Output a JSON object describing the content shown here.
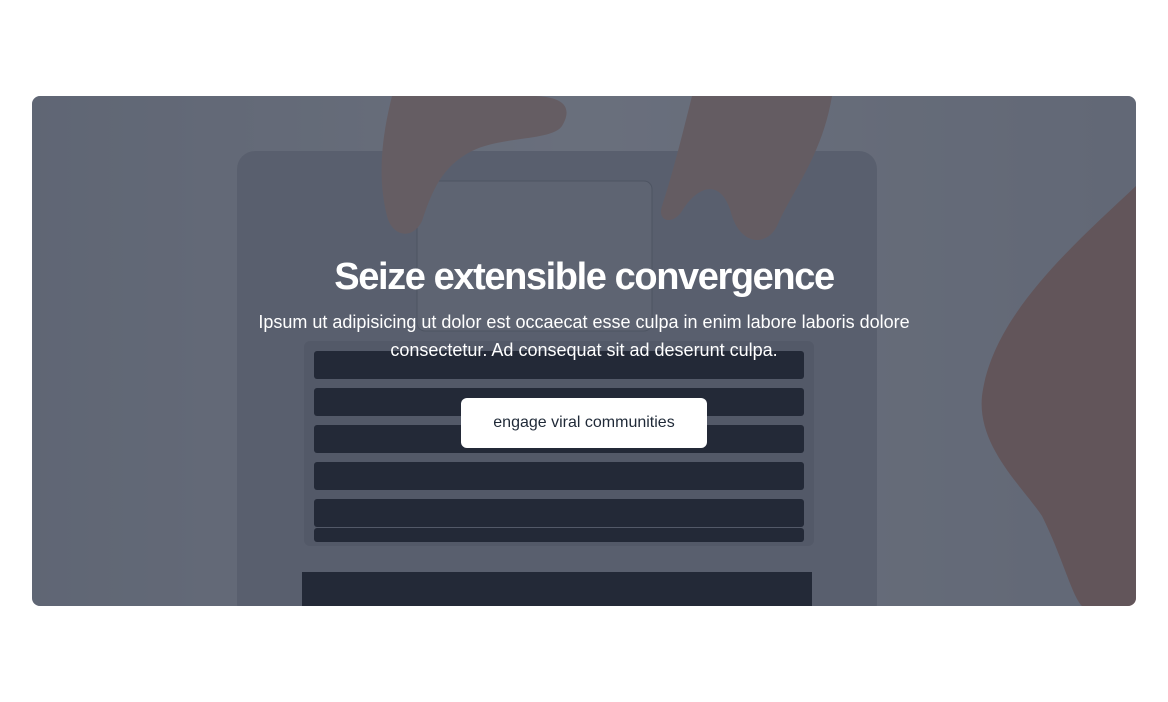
{
  "hero": {
    "title": "Seize extensible convergence",
    "subtitle": "Ipsum ut adipisicing ut dolor est occaecat esse culpa in enim labore laboris dolore consectetur. Ad consequat sit ad deserunt culpa.",
    "cta_label": "engage viral communities",
    "background_image": "laptop-keyboard-hands-photo"
  },
  "colors": {
    "overlay": "#1f263a",
    "cta_background": "#ffffff",
    "cta_text": "#1f2937",
    "text": "#ffffff"
  }
}
